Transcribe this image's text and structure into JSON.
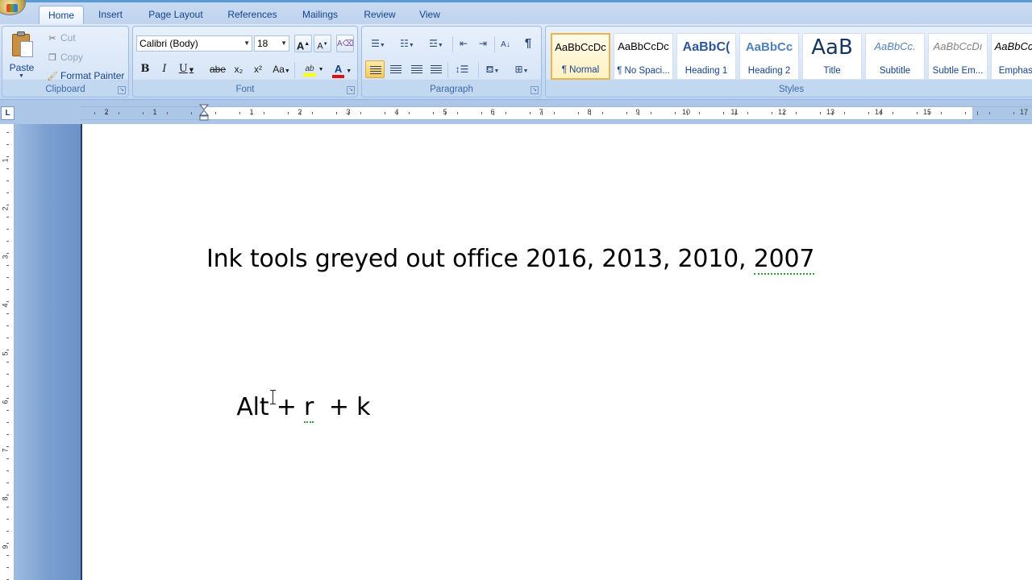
{
  "tabs": [
    "Home",
    "Insert",
    "Page Layout",
    "References",
    "Mailings",
    "Review",
    "View"
  ],
  "active_tab": "Home",
  "clipboard": {
    "paste_label": "Paste",
    "cut_label": "Cut",
    "copy_label": "Copy",
    "format_painter_label": "Format Painter",
    "group_label": "Clipboard"
  },
  "font": {
    "font_name": "Calibri (Body)",
    "font_size": "18",
    "group_label": "Font",
    "bold": "B",
    "italic": "I",
    "underline": "U",
    "strike": "abe",
    "subscript": "x₂",
    "superscript": "x²",
    "change_case": "Aa",
    "grow": "A",
    "shrink": "A",
    "highlight": "ab",
    "font_color": "A"
  },
  "paragraph": {
    "group_label": "Paragraph",
    "pilcrow": "¶"
  },
  "styles": {
    "group_label": "Styles",
    "items": [
      {
        "sample": "AaBbCcDc",
        "name": "¶ Normal"
      },
      {
        "sample": "AaBbCcDc",
        "name": "¶ No Spaci..."
      },
      {
        "sample": "AaBbC(",
        "name": "Heading 1"
      },
      {
        "sample": "AaBbCc",
        "name": "Heading 2"
      },
      {
        "sample": "AaB",
        "name": "Title"
      },
      {
        "sample": "AaBbCc.",
        "name": "Subtitle"
      },
      {
        "sample": "AaBbCcDı",
        "name": "Subtle Em..."
      },
      {
        "sample": "AaBbCcDı",
        "name": "Emphasis"
      }
    ]
  },
  "ruler": {
    "tab_selector": "L",
    "numbers": [
      "2",
      "1",
      "1",
      "2",
      "3",
      "4",
      "5",
      "6",
      "7",
      "8",
      "9",
      "10",
      "11",
      "12",
      "13",
      "14",
      "15",
      "17"
    ],
    "vnumbers": [
      "1",
      "2",
      "3",
      "4",
      "5",
      "6",
      "7",
      "8",
      "9",
      "10"
    ]
  },
  "document": {
    "line1_prefix": "Ink tools greyed out office 2016, 2013, 2010, ",
    "line1_squiggle": "2007",
    "line2_prefix": "Alt + ",
    "line2_squiggle": "r",
    "line2_suffix": "  + k"
  },
  "colors": {
    "accent": "#15428b",
    "ribbon_border": "#8db2e3",
    "highlight_yellow": "#ffff00",
    "font_red": "#e01010",
    "selected_style_border": "#e8b64c"
  }
}
